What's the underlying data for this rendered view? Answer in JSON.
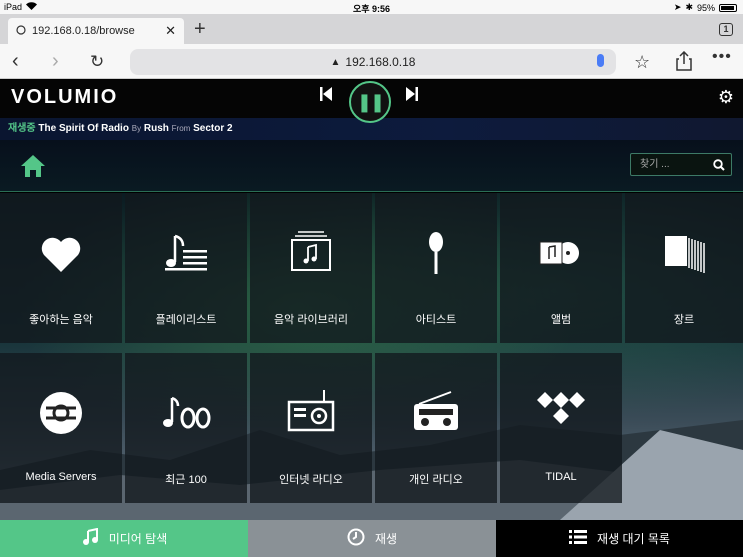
{
  "status_bar": {
    "device": "iPad",
    "time": "오후 9:56",
    "battery": "95%",
    "battery_level": 0.95
  },
  "browser": {
    "tab_title": "192.168.0.18/browse",
    "tab_count": "1",
    "url": "192.168.0.18"
  },
  "app": {
    "logo": "VOLUMIO",
    "now_playing": {
      "label": "재생중",
      "track": "The Spirit Of Radio",
      "by": "By",
      "artist": "Rush",
      "from": "From",
      "album": "Sector 2"
    },
    "search_placeholder": "찾기 ..."
  },
  "tiles": [
    {
      "label": "좋아하는 음악",
      "icon": "heart-icon"
    },
    {
      "label": "플레이리스트",
      "icon": "playlist-icon"
    },
    {
      "label": "음악 라이브러리",
      "icon": "music-library-icon"
    },
    {
      "label": "아티스트",
      "icon": "microphone-icon"
    },
    {
      "label": "앨범",
      "icon": "album-icon"
    },
    {
      "label": "장르",
      "icon": "genre-icon"
    },
    {
      "label": "Media Servers",
      "icon": "media-server-icon"
    },
    {
      "label": "최근 100",
      "icon": "last-100-icon"
    },
    {
      "label": "인터넷 라디오",
      "icon": "web-radio-icon"
    },
    {
      "label": "개인 라디오",
      "icon": "personal-radio-icon"
    },
    {
      "label": "TIDAL",
      "icon": "tidal-icon"
    }
  ],
  "bottom_tabs": {
    "browse": "미디어 탐색",
    "playback": "재생",
    "queue": "재생 대기 목록"
  },
  "colors": {
    "accent": "#54c688",
    "playback_tab": "#8a9196",
    "queue_tab": "#000000"
  }
}
